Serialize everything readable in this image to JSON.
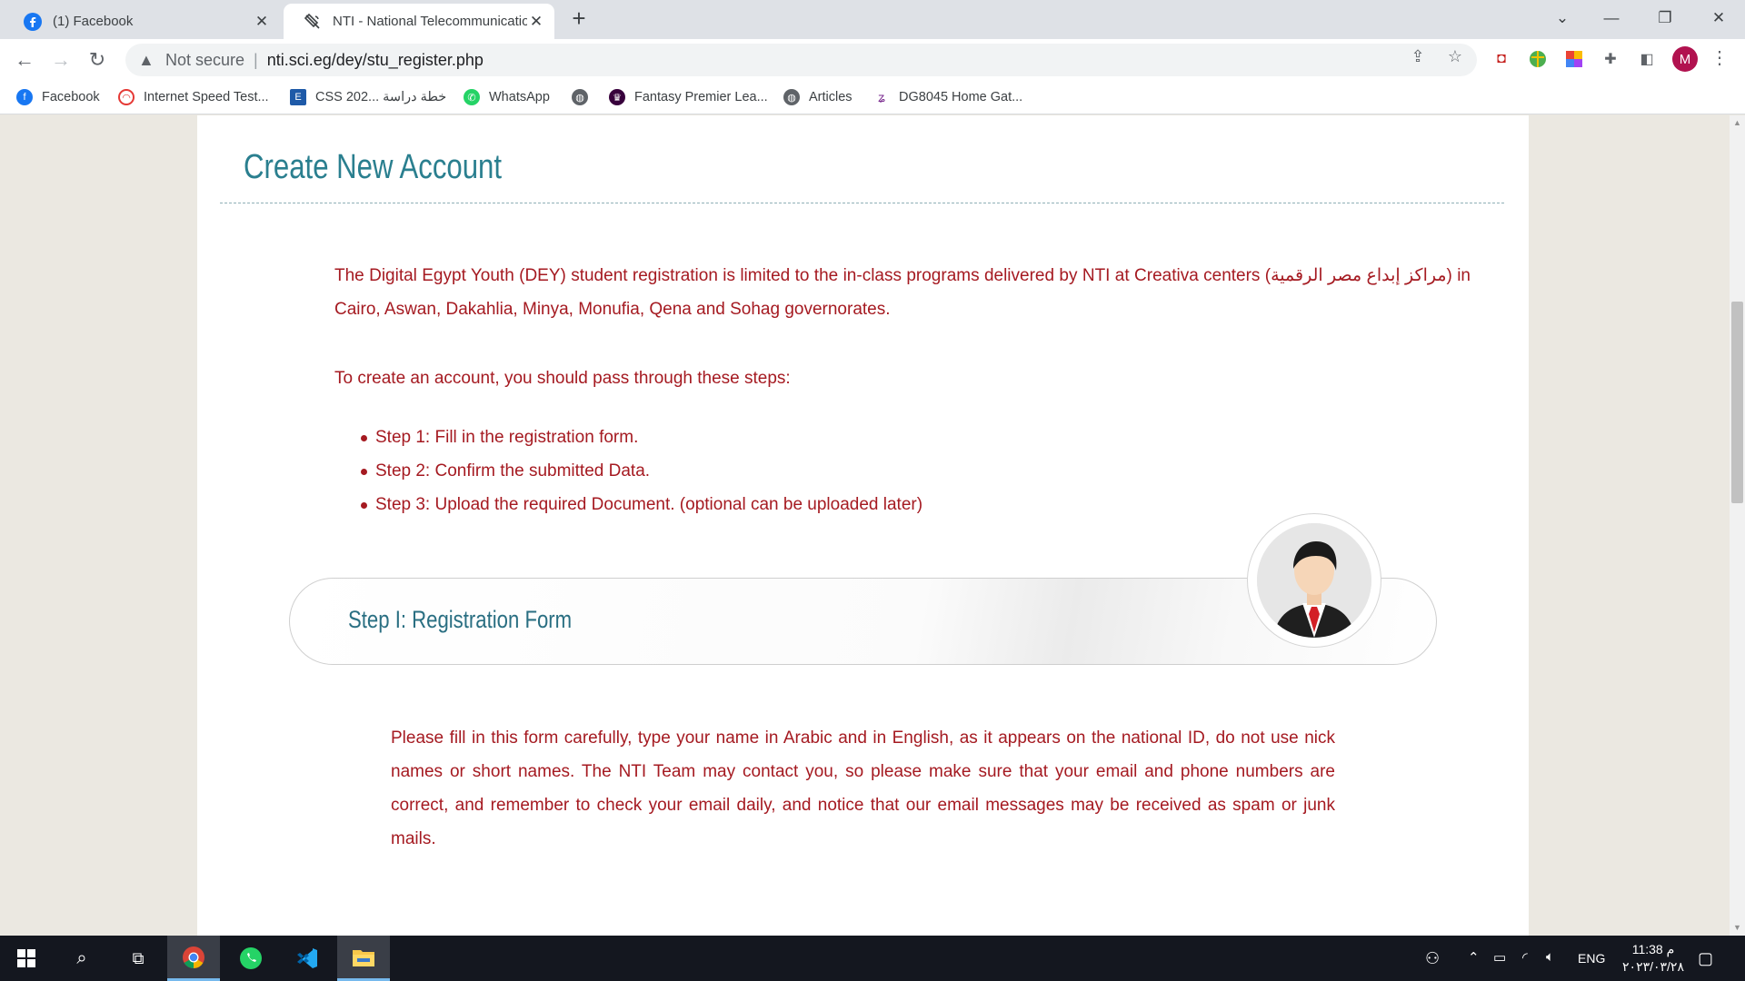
{
  "browser": {
    "tabs": [
      {
        "title": "(1) Facebook",
        "icon": "facebook-icon",
        "active": false
      },
      {
        "title": "NTI - National Telecommunications Institute",
        "icon": "nti-satellite-icon",
        "active": true
      }
    ],
    "address": {
      "security_label": "Not secure",
      "url": "nti.sci.eg/dey/stu_register.php"
    },
    "profile_initial": "M",
    "bookmarks": [
      {
        "label": "Facebook",
        "icon": "facebook-icon"
      },
      {
        "label": "Internet Speed Test...",
        "icon": "speedtest-icon"
      },
      {
        "label": "CSS 202... خطة دراسة",
        "icon": "e-icon"
      },
      {
        "label": "WhatsApp",
        "icon": "whatsapp-icon"
      },
      {
        "label": "",
        "icon": "globe-icon"
      },
      {
        "label": "Fantasy Premier Lea...",
        "icon": "premier-league-icon"
      },
      {
        "label": "Articles",
        "icon": "globe-icon"
      },
      {
        "label": "DG8045 Home Gat...",
        "icon": "router-icon"
      }
    ]
  },
  "page": {
    "heading": "Create New Account",
    "intro": "The Digital Egypt Youth (DEY) student registration is limited to the in-class programs delivered by NTI at Creativa centers (مراكز إبداع مصر الرقمية) in Cairo, Aswan, Dakahlia, Minya, Monufia, Qena and Sohag governorates.",
    "steps_intro": "To create an account, you should pass through these steps:",
    "steps": [
      "Step 1: Fill in the registration form.",
      "Step 2: Confirm the submitted Data.",
      "Step 3: Upload the required Document. (optional can be uploaded later)"
    ],
    "step_banner_title": "Step I: Registration Form",
    "form_note": "Please fill in this form carefully, type your name in Arabic and in English, as it appears on the national ID, do not use nick names or short names. The NTI Team may contact you, so please make sure that your email and phone numbers are correct, and remember to check your email daily, and notice that our email messages may be received as spam or junk mails."
  },
  "taskbar": {
    "apps": [
      "start-icon",
      "search-icon",
      "task-view-icon",
      "chrome-icon",
      "whatsapp-icon",
      "vscode-icon",
      "file-explorer-icon"
    ],
    "language": "ENG",
    "time": "11:38 م",
    "date": "٢٠٢٣/٠٣/٢٨"
  },
  "colors": {
    "accent_text": "#a51a21",
    "heading": "#2a7f8f",
    "profile": "#b1124f"
  }
}
